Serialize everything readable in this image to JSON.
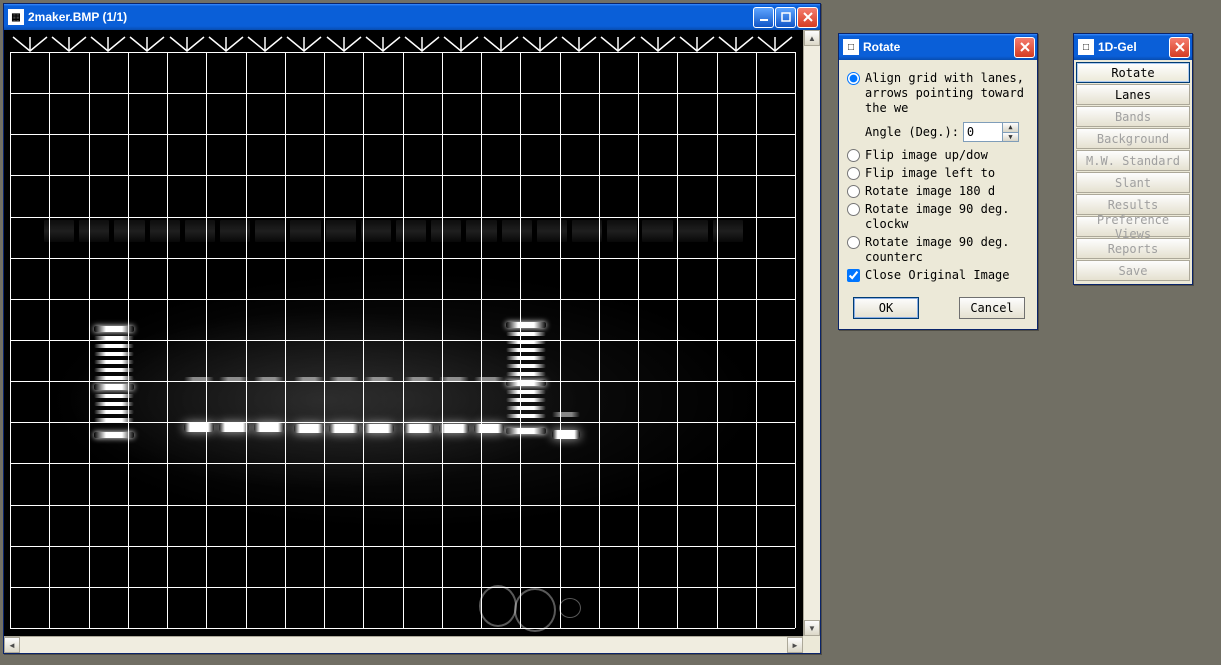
{
  "mainWindow": {
    "title": "2maker.BMP (1/1)"
  },
  "rotateDialog": {
    "title": "Rotate",
    "options": {
      "align": "Align grid with lanes,",
      "alignSub": "arrows pointing toward the we",
      "angleLabel": "Angle (Deg.):",
      "angleValue": "0",
      "flipUpDown": "Flip image up/dow",
      "flipLeftTo": "Flip image left to",
      "rotate180": "Rotate image 180 d",
      "rotate90cw": "Rotate image 90 deg. clockw",
      "rotate90ccw": "Rotate image 90 deg. counterc",
      "closeOriginal": "Close Original Image"
    },
    "buttons": {
      "ok": "OK",
      "cancel": "Cancel"
    }
  },
  "gelToolbox": {
    "title": "1D-Gel",
    "buttons": [
      {
        "label": "Rotate",
        "enabled": true,
        "active": true
      },
      {
        "label": "Lanes",
        "enabled": true,
        "active": false
      },
      {
        "label": "Bands",
        "enabled": false,
        "active": false
      },
      {
        "label": "Background",
        "enabled": false,
        "active": false
      },
      {
        "label": "M.W. Standard",
        "enabled": false,
        "active": false
      },
      {
        "label": "Slant",
        "enabled": false,
        "active": false
      },
      {
        "label": "Results",
        "enabled": false,
        "active": false
      },
      {
        "label": "Preference Views",
        "enabled": false,
        "active": false
      },
      {
        "label": "Reports",
        "enabled": false,
        "active": false
      },
      {
        "label": "Save",
        "enabled": false,
        "active": false
      }
    ]
  }
}
